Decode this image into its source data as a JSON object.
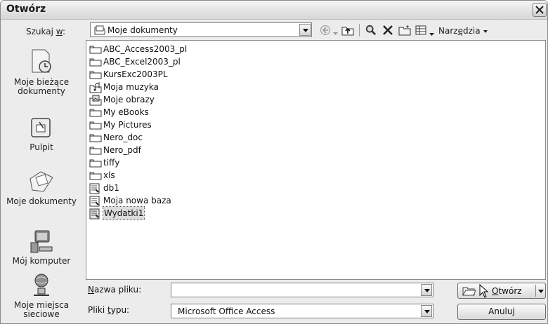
{
  "dialog": {
    "title": "Otwórz"
  },
  "look_in": {
    "label_pre": "Szukaj ",
    "label_key": "w",
    "label_post": ":",
    "value": "Moje dokumenty"
  },
  "toolbar": {
    "tools_pre": "Narz",
    "tools_key": "ę",
    "tools_post": "dzia"
  },
  "places": [
    {
      "label": "Moje bieżące dokumenty",
      "icon": "recent-documents-icon"
    },
    {
      "label": "Pulpit",
      "icon": "desktop-icon"
    },
    {
      "label": "Moje dokumenty",
      "icon": "my-documents-icon"
    },
    {
      "label": "Mój komputer",
      "icon": "my-computer-icon"
    },
    {
      "label": "Moje miejsca sieciowe",
      "icon": "network-places-icon"
    }
  ],
  "files": [
    {
      "name": "ABC_Access2003_pl",
      "kind": "folder"
    },
    {
      "name": "ABC_Excel2003_pl",
      "kind": "folder"
    },
    {
      "name": "KursExc2003PL",
      "kind": "folder"
    },
    {
      "name": "Moja muzyka",
      "kind": "music-folder"
    },
    {
      "name": "Moje obrazy",
      "kind": "pictures-folder"
    },
    {
      "name": "My eBooks",
      "kind": "folder"
    },
    {
      "name": "My Pictures",
      "kind": "folder"
    },
    {
      "name": "Nero_doc",
      "kind": "folder"
    },
    {
      "name": "Nero_pdf",
      "kind": "folder"
    },
    {
      "name": "tiffy",
      "kind": "folder"
    },
    {
      "name": "xls",
      "kind": "folder"
    },
    {
      "name": "db1",
      "kind": "database"
    },
    {
      "name": "Moja nowa baza",
      "kind": "database"
    },
    {
      "name": "Wydatki1",
      "kind": "database",
      "selected": true
    }
  ],
  "file_name": {
    "label_key": "N",
    "label_rest": "azwa pliku:",
    "value": ""
  },
  "file_type": {
    "label_pre": "Pliki ",
    "label_key": "t",
    "label_post": "ypu:",
    "value": "Microsoft Office Access"
  },
  "buttons": {
    "open_key": "O",
    "open_rest": "twórz",
    "cancel": "Anuluj"
  }
}
